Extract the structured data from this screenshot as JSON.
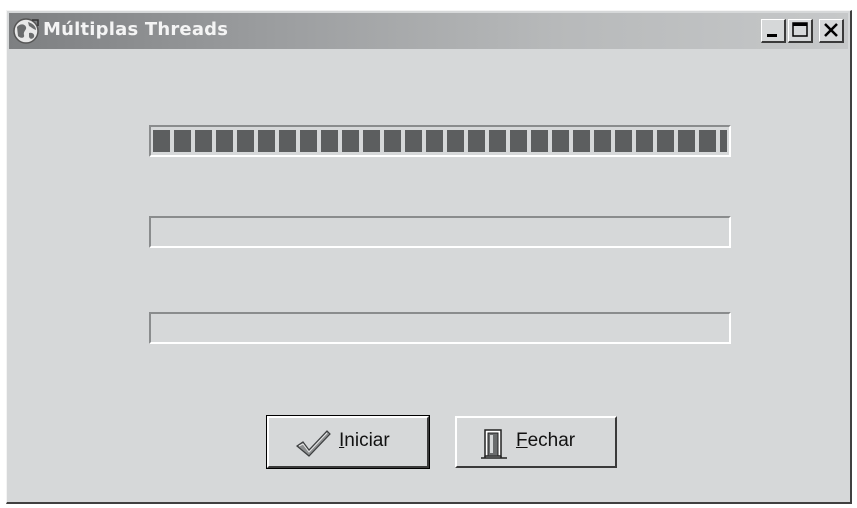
{
  "window": {
    "title": "Múltiplas Threads",
    "icon": "app-globe-icon",
    "controls": {
      "minimize": "minimize-icon",
      "maximize": "maximize-icon",
      "close": "close-icon"
    }
  },
  "progress_bars": [
    {
      "name": "progress-bar-1",
      "value": 1.0
    },
    {
      "name": "progress-bar-2",
      "value": 0.0
    },
    {
      "name": "progress-bar-3",
      "value": 0.0
    }
  ],
  "buttons": {
    "iniciar": {
      "label": "Iniciar",
      "accel": "I",
      "rest": "niciar",
      "icon": "checkmark-icon"
    },
    "fechar": {
      "label": "Fechar",
      "accel": "F",
      "rest": "echar",
      "icon": "door-exit-icon"
    }
  },
  "colors": {
    "progress_fill": "#5c5e5f",
    "face": "#d6d8d9"
  }
}
